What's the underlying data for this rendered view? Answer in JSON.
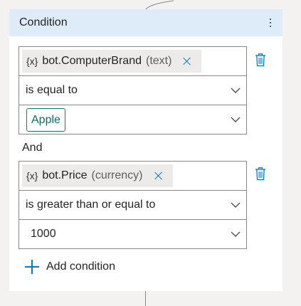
{
  "node": {
    "title": "Condition",
    "more_icon": "more-vertical-icon"
  },
  "conditions": [
    {
      "variable_icon": "{x}",
      "variable_name": "bot.ComputerBrand",
      "variable_type": "(text)",
      "operator": "is equal to",
      "value": "Apple",
      "value_style": "tag"
    },
    {
      "variable_icon": "{x}",
      "variable_name": "bot.Price",
      "variable_type": "(currency)",
      "operator": "is greater than or equal to",
      "value": "1000",
      "value_style": "text"
    }
  ],
  "joiner": "And",
  "add_condition_label": "Add condition",
  "colors": {
    "header_bg": "#deecf9",
    "accent": "#0078d4",
    "tag_border": "#0e7a7a",
    "chip_bg": "#edebe9"
  }
}
